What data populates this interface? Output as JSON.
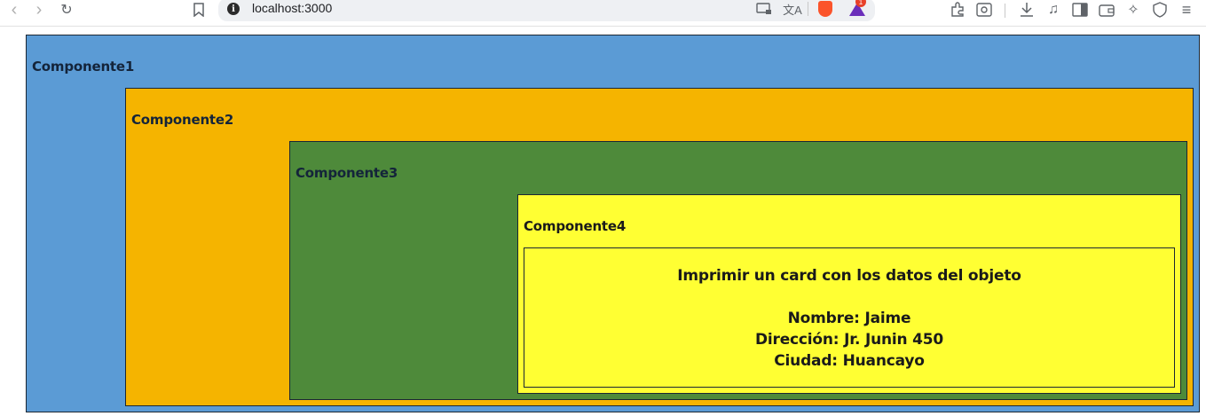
{
  "browser": {
    "url": "localhost:3000",
    "notification_count": "1"
  },
  "components": {
    "c1_label": "Componente1",
    "c2_label": "Componente2",
    "c3_label": "Componente3",
    "c4_label": "Componente4"
  },
  "card": {
    "title": "Imprimir un card con los datos del objeto",
    "nombre": "Nombre: Jaime",
    "direccion": "Dirección: Jr. Junin 450",
    "ciudad": "Ciudad: Huancayo"
  },
  "colors": {
    "componente1": "#5b9bd5",
    "componente2": "#f5b400",
    "componente3": "#4e8a3a",
    "componente4": "#ffff33"
  }
}
